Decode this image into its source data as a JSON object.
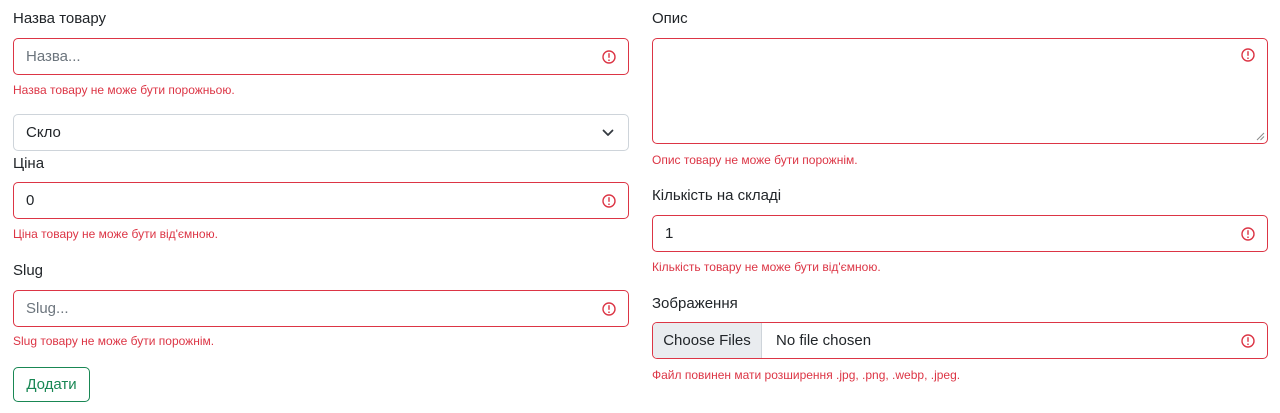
{
  "form": {
    "name": {
      "label": "Назва товару",
      "placeholder": "Назва...",
      "error": "Назва товару не може бути порожньою."
    },
    "category": {
      "selected": "Скло"
    },
    "price": {
      "label": "Ціна",
      "value": "0",
      "error": "Ціна товару не може бути від'ємною."
    },
    "slug": {
      "label": "Slug",
      "placeholder": "Slug...",
      "error": "Slug товару не може бути порожнім."
    },
    "description": {
      "label": "Опис",
      "value": "",
      "error": "Опис товару не може бути порожнім."
    },
    "stock": {
      "label": "Кількість на складі",
      "value": "1",
      "error": "Кількість товару не може бути від'ємною."
    },
    "image": {
      "label": "Зображення",
      "button": "Choose Files",
      "status": "No file chosen",
      "error": "Файл повинен мати розширення .jpg, .png, .webp, .jpeg."
    },
    "submit_label": "Додати"
  },
  "colors": {
    "error": "#dc3545",
    "success": "#198754",
    "border": "#ced4da",
    "file_button_bg": "#e9ecef"
  },
  "icons": {
    "field_error": "exclamation-circle-icon",
    "select_arrow": "chevron-down-icon"
  }
}
